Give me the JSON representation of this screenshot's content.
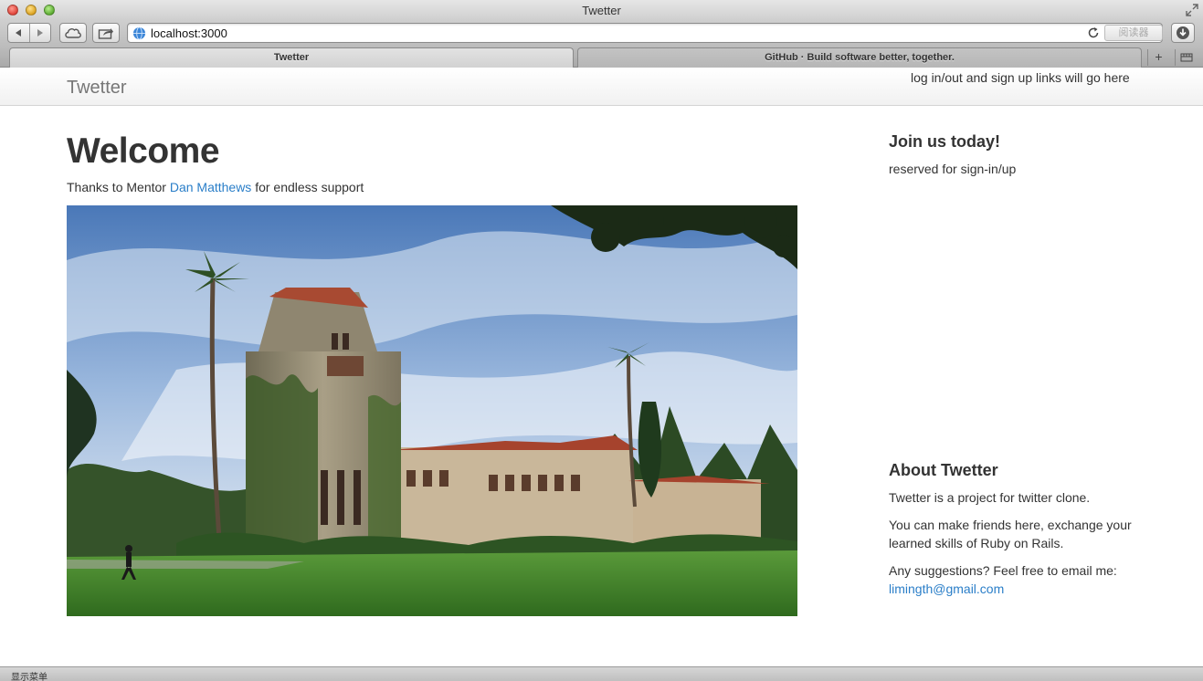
{
  "window": {
    "title": "Twetter"
  },
  "toolbar": {
    "url": "localhost:3000",
    "reader_label": "阅读器"
  },
  "tabs": [
    {
      "label": "Twetter",
      "active": true
    },
    {
      "label": "GitHub · Build software better, together.",
      "active": false
    }
  ],
  "tabbar": {
    "new_tab": "+"
  },
  "page": {
    "brand": "Twetter",
    "nav_note": "log in/out and sign up links will go here",
    "heading": "Welcome",
    "thanks_prefix": "Thanks to Mentor ",
    "mentor_name": "Dan Matthews",
    "thanks_suffix": " for endless support"
  },
  "sidebar": {
    "join_heading": "Join us today!",
    "reserved": "reserved for sign-in/up",
    "about_heading": "About Twetter",
    "about_p1": "Twetter is a project for twitter clone.",
    "about_p2": "You can make friends here, exchange your learned skills of Ruby on Rails.",
    "about_p3": "Any suggestions? Feel free to email me:",
    "email": "limingth@gmail.com"
  },
  "statusbar": {
    "text": "显示菜单"
  },
  "colors": {
    "link": "#2a7ec8",
    "text": "#333333",
    "brand": "#777777"
  }
}
